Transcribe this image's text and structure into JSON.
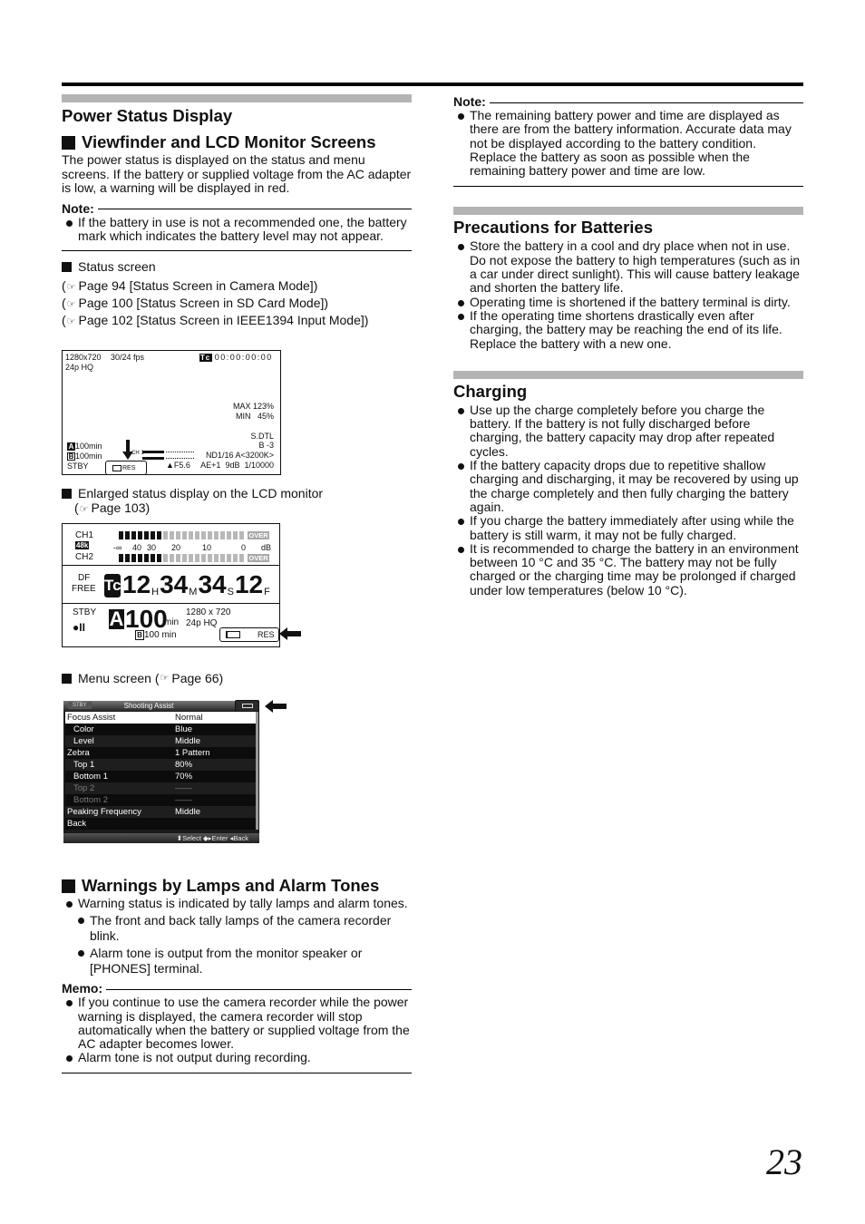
{
  "page": {
    "number": "23"
  },
  "left": {
    "section_title": "Power Status Display",
    "sub1": {
      "title": "Viewfinder and LCD Monitor Screens",
      "body": "The power status is displayed on the status and menu screens. If the battery or supplied voltage from the AC adapter is low, a warning will be displayed in red."
    },
    "note1": {
      "label": "Note:",
      "items": [
        "If the battery in use is not a recommended one, the battery mark which indicates the battery level may not appear."
      ]
    },
    "status_caption": "Status screen",
    "status_refs": [
      "Page 94 [Status Screen in Camera Mode])",
      "Page 100 [Status Screen in SD Card Mode])",
      "Page 102 [Status Screen in IEEE1394 Input Mode])"
    ],
    "ref_open": "(",
    "ref_icon": "☞",
    "status_screen": {
      "resolution": "1280x720",
      "fps": "30/24 fps",
      "format": "24p HQ",
      "tc_label": "Tc",
      "timecode": "00:00:00:00",
      "max": "MAX 123%",
      "min": "MIN   45%",
      "sdtl": "S.DTL",
      "b": "B -3",
      "nd": "ND1/16 A<3200K>",
      "ae": "AE+1  9dB  1/10000",
      "a_label": "A",
      "a_remaining": "100min",
      "b_label": "B",
      "b_remaining": "100min",
      "stby": "STBY",
      "res": "RES",
      "ch1": "CH 1",
      "iris": "F5.6"
    },
    "lcd_caption": "Enlarged status display on the LCD monitor",
    "lcd_ref": "Page 103)",
    "lcd": {
      "ch1": "CH1",
      "ch2": "CH2",
      "rate": "48k",
      "over": "OVER",
      "scale": [
        "-∞",
        "40",
        "30",
        "20",
        "10",
        "0",
        "dB"
      ],
      "ch1_level_segments": 7,
      "ch2_level_segments": 7,
      "total_segments": 20,
      "df": "DF",
      "free": "FREE",
      "tc_label": "Tc",
      "hours": "12",
      "h": "H",
      "minutes": "34",
      "m": "M",
      "seconds": "34",
      "s": "S",
      "frames": "12",
      "f": "F",
      "stby": "STBY",
      "rec_icon": "●II",
      "a_label": "A",
      "a_value": "100",
      "a_unit": "min",
      "b_label": "B",
      "b_value": "100 min",
      "resolution": "1280 x 720",
      "format": "24p HQ",
      "res": "RES"
    },
    "menu_caption": "Menu screen (",
    "menu_ref": "Page 66)",
    "menu": {
      "stby": "STBY",
      "title": "Shooting Assist",
      "rows": [
        {
          "label": "Focus Assist",
          "value": "Normal",
          "state": "selected"
        },
        {
          "label": "Color",
          "value": "Blue",
          "state": "indent"
        },
        {
          "label": "Level",
          "value": "Middle",
          "state": "indent"
        },
        {
          "label": "Zebra",
          "value": "1 Pattern",
          "state": ""
        },
        {
          "label": "Top 1",
          "value": "80%",
          "state": "indent"
        },
        {
          "label": "Bottom 1",
          "value": "70%",
          "state": "indent"
        },
        {
          "label": "Top 2",
          "value": "——",
          "state": "indent dim"
        },
        {
          "label": "Bottom 2",
          "value": "——",
          "state": "indent dim"
        },
        {
          "label": "Peaking Frequency",
          "value": "Middle",
          "state": ""
        },
        {
          "label": "Back",
          "value": "",
          "state": ""
        }
      ],
      "footer": "⬍Select  ◆▸Enter  ◂Back"
    },
    "sub2": {
      "title": "Warnings by Lamps and Alarm Tones",
      "items": [
        "Warning status is indicated by tally lamps and alarm tones."
      ],
      "subitems": [
        "The front and back tally lamps of the camera recorder blink.",
        "Alarm tone is output from the monitor speaker or [PHONES] terminal."
      ]
    },
    "memo": {
      "label": "Memo:",
      "items": [
        "If you continue to use the camera recorder while the power warning is displayed, the camera recorder will stop automatically when the battery or supplied voltage from the AC adapter becomes lower.",
        "Alarm tone is not output during recording."
      ]
    }
  },
  "right": {
    "note": {
      "label": "Note:",
      "items": [
        "The remaining battery power and time are displayed as there are from the battery information. Accurate data may not be displayed according to the battery condition. Replace the battery as soon as possible when the remaining battery power and time are low."
      ]
    },
    "precautions": {
      "title": "Precautions for Batteries",
      "items": [
        "Store the battery in a cool and dry place when not in use. Do not expose the battery to high temperatures (such as in a car under direct sunlight). This will cause battery leakage and shorten the battery life.",
        "Operating time is shortened if the battery terminal is dirty.",
        "If the operating time shortens drastically even after charging, the battery may be reaching the end of its life. Replace the battery with a new one."
      ]
    },
    "charging": {
      "title": "Charging",
      "items": [
        "Use up the charge completely before you charge the battery. If the battery is not fully discharged before charging, the battery capacity may drop after repeated cycles.",
        "If the battery capacity drops due to repetitive shallow charging and discharging, it may be recovered by using up the charge completely and then fully charging the battery again.",
        "If you charge the battery immediately after using while the battery is still warm, it may not be fully charged.",
        "It is recommended to charge the battery in an environment between 10 °C and 35 °C. The battery may not be fully charged or the charging time may be prolonged if charged under low temperatures (below 10 °C)."
      ]
    }
  }
}
